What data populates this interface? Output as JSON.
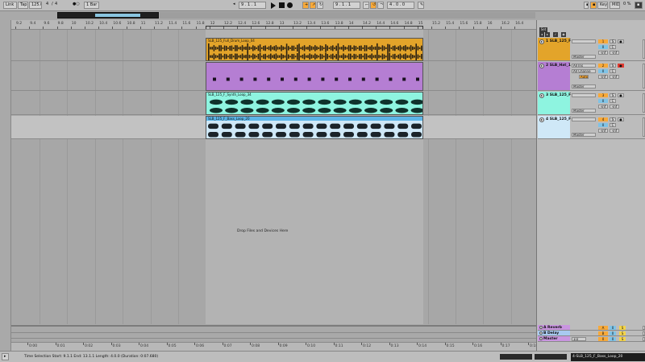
{
  "transport": {
    "link": "Link",
    "tap": "Tap",
    "tempo": "125.00",
    "sig_num": "4",
    "sig_den": "4",
    "metro": "●○",
    "quant": "1 Bar",
    "position": "9 . 1 . 1",
    "loop_start": "9 . 1 . 1",
    "loop_length": "4 . 0 . 0",
    "key": "Key",
    "midi": "MIDI",
    "cpu": "0 %",
    "draw": "W"
  },
  "ruler_top": [
    "9.2",
    "9.4",
    "9.6",
    "9.8",
    "10",
    "10.2",
    "10.4",
    "10.6",
    "10.8",
    "11",
    "11.2",
    "11.4",
    "11.6",
    "11.8",
    "12",
    "12.2",
    "12.4",
    "12.6",
    "12.8",
    "13",
    "13.2",
    "13.4",
    "13.6",
    "13.8",
    "14",
    "14.2",
    "14.4",
    "14.6",
    "14.8",
    "15",
    "15.2",
    "15.4",
    "15.6",
    "15.8",
    "16",
    "16.2",
    "16.4"
  ],
  "ruler_bottom": [
    "0:00",
    "0:01",
    "0:02",
    "0:03",
    "0:04",
    "0:05",
    "0:06",
    "0:07",
    "0:08",
    "0:09",
    "0:10",
    "0:11",
    "0:12",
    "0:13",
    "0:14",
    "0:15",
    "0:16",
    "0:17",
    "0:18",
    "0:19",
    "0:20"
  ],
  "tracks": [
    {
      "clip": "SLB_125_Full_Drum_Loop_04",
      "color": "#e3a42a",
      "wave": "drums",
      "mix_name": "1 SLB_125_F",
      "io_in": "",
      "io_out": "Master",
      "vol": "0",
      "pan": "C",
      "send_a": "-inf",
      "send_b": "-inf",
      "num": "1",
      "mixcolor": "#e3a42a"
    },
    {
      "clip": "",
      "color": "#b57ed3",
      "wave": "midi",
      "mix_name": "2 SLB_Hat_1",
      "io_in": "All Ins",
      "io_in2": "All Channe",
      "io_mon": "Auto",
      "io_out": "Master",
      "vol": "0",
      "pan": "C",
      "send_a": "-inf",
      "send_b": "-inf",
      "num": "2",
      "mixcolor": "#b57ed3"
    },
    {
      "clip": "SLB_125_F_Synth_Loop_34",
      "color": "#8ef4e0",
      "wave": "synth",
      "mix_name": "3 SLB_125_F",
      "io_in": "",
      "io_out": "Master",
      "vol": "0",
      "pan": "C",
      "send_a": "-inf",
      "send_b": "-inf",
      "num": "3",
      "mixcolor": "#8ef4e0"
    },
    {
      "clip": "SLB_125_F_Bass_Loop_20",
      "color": "#5cb5e8",
      "wave": "bass",
      "mix_name": "4 SLB_125_F",
      "io_in": "",
      "io_out": "Master",
      "vol": "0",
      "pan": "C",
      "send_a": "-inf",
      "send_b": "-inf",
      "num": "4",
      "mixcolor": "#cfe8f7"
    }
  ],
  "drop_message": "Drop Files and Devices Here",
  "returns": [
    {
      "name": "A Reverb",
      "color": "#c995e0",
      "num": "A"
    },
    {
      "name": "B Delay",
      "color": "#a8c9f0",
      "num": "B"
    },
    {
      "name": "Master",
      "color": "#c995e0",
      "num": "0",
      "io": "1/2"
    }
  ],
  "status": {
    "text": "Time Selection   Start: 9.1.1   End: 13.1.1   Length: 4.0.0   (Duration: 0:07.680)",
    "right": "4-SLB_125_F_Bass_Loop_20"
  }
}
